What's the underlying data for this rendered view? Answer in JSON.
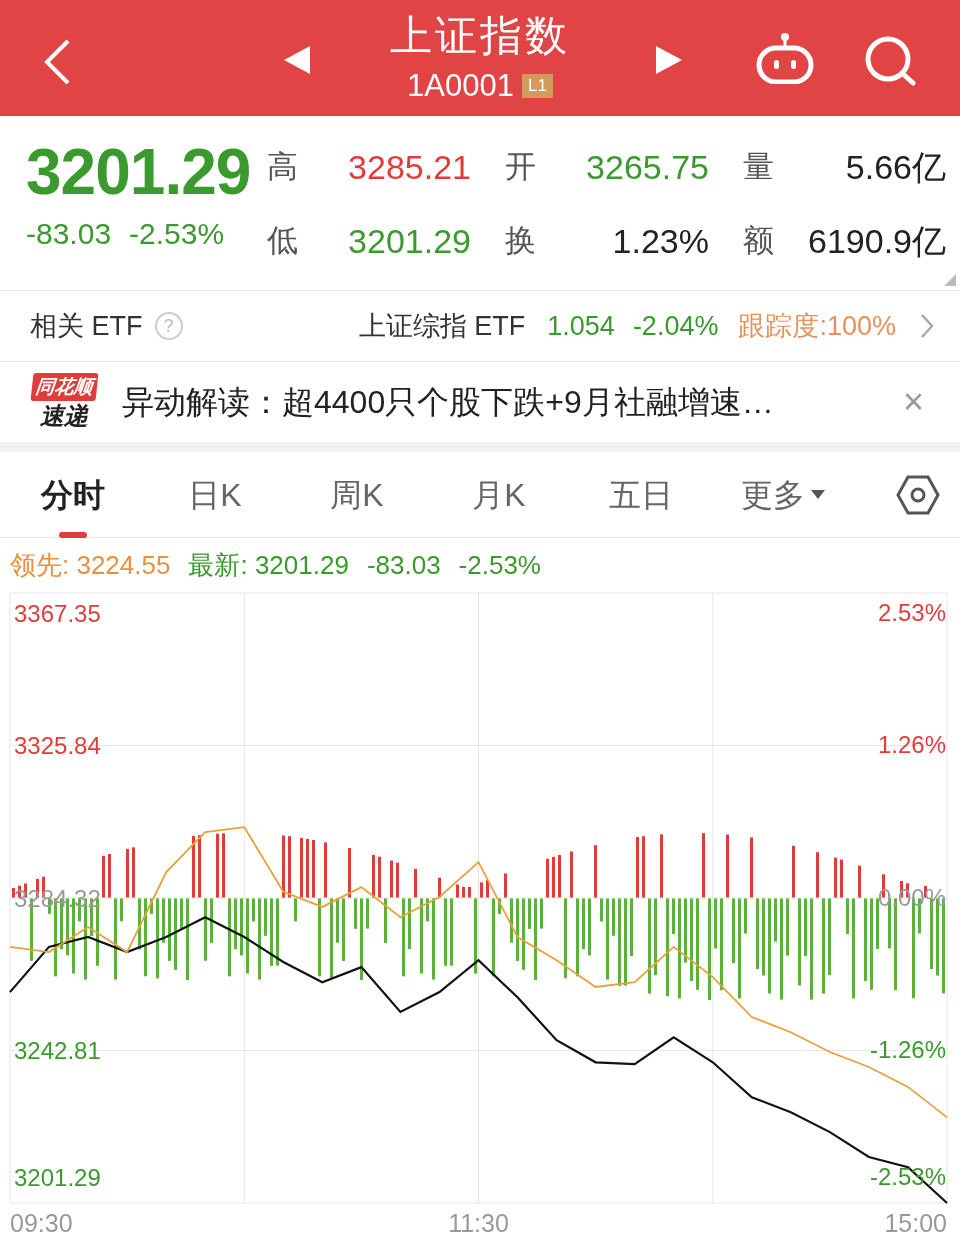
{
  "header": {
    "title": "上证指数",
    "code": "1A0001",
    "badge": "L1"
  },
  "quote": {
    "price": "3201.29",
    "color": "#3a9a2e",
    "change": "-83.03",
    "change_pct": "-2.53%",
    "stats": [
      {
        "label": "高",
        "value": "3285.21",
        "color": "#e03c3c"
      },
      {
        "label": "开",
        "value": "3265.75",
        "color": "#3a9a2e"
      },
      {
        "label": "量",
        "value": "5.66亿",
        "color": "#222222"
      },
      {
        "label": "低",
        "value": "3201.29",
        "color": "#3a9a2e"
      },
      {
        "label": "换",
        "value": "1.23%",
        "color": "#222222"
      },
      {
        "label": "额",
        "value": "6190.9亿",
        "color": "#222222"
      }
    ]
  },
  "etf": {
    "label": "相关 ETF",
    "help": "?",
    "name": "上证综指 ETF",
    "price": "1.054",
    "change_pct": "-2.04%",
    "tracking": "跟踪度:100%"
  },
  "news": {
    "logo_top": "同花顺",
    "logo_bottom": "速递",
    "text": "异动解读：超4400只个股下跌+9月社融增速…",
    "close": "×"
  },
  "tabs": [
    {
      "label": "分时",
      "selected": true,
      "kind": "tab"
    },
    {
      "label": "日K",
      "selected": false,
      "kind": "tab"
    },
    {
      "label": "周K",
      "selected": false,
      "kind": "tab"
    },
    {
      "label": "月K",
      "selected": false,
      "kind": "tab"
    },
    {
      "label": "五日",
      "selected": false,
      "kind": "tab"
    },
    {
      "label": "更多",
      "selected": false,
      "kind": "dropdown"
    }
  ],
  "legend": {
    "lead": "领先: 3224.55",
    "latest": "最新: 3201.29",
    "change": "-83.03",
    "change_pct": "-2.53%"
  },
  "chart": {
    "time_labels": [
      "09:30",
      "11:30",
      "15:00"
    ],
    "right_axis_labels": [
      "2.53%",
      "1.26%",
      "0.00%",
      "-1.26%",
      "-2.53%"
    ],
    "chart_data": {
      "type": "line",
      "series": [
        {
          "color": "#111111",
          "values": [
            3258.7,
            3271.0,
            3273.7,
            3269.6,
            3273.7,
            3279.1,
            3273.7,
            3266.9,
            3261.4,
            3265.5,
            3253.3,
            3258.7,
            3267.4,
            3257.3,
            3245.6,
            3239.6,
            3239.1,
            3246.4,
            3239.6,
            3230.1,
            3226.0,
            3220.6,
            3213.8,
            3211.0,
            3201.3
          ]
        },
        {
          "color": "#e8a03c",
          "values": [
            3271.0,
            3269.6,
            3276.4,
            3269.6,
            3291.4,
            3302.3,
            3303.6,
            3286.0,
            3281.9,
            3287.3,
            3279.1,
            3284.6,
            3294.1,
            3273.7,
            3267.4,
            3260.1,
            3261.4,
            3271.0,
            3262.8,
            3251.9,
            3247.8,
            3242.4,
            3238.3,
            3232.9,
            3224.6
          ]
        }
      ],
      "ylim": [
        3201.29,
        3367.35
      ],
      "grid": true,
      "yticks": [
        {
          "value": 3367.35,
          "label": "3367.35"
        },
        {
          "value": 3325.84,
          "label": "3325.84"
        },
        {
          "value": 3284.32,
          "label": "3284.32"
        },
        {
          "value": 3242.81,
          "label": "3242.81"
        },
        {
          "value": 3201.29,
          "label": "3201.29"
        }
      ]
    }
  }
}
